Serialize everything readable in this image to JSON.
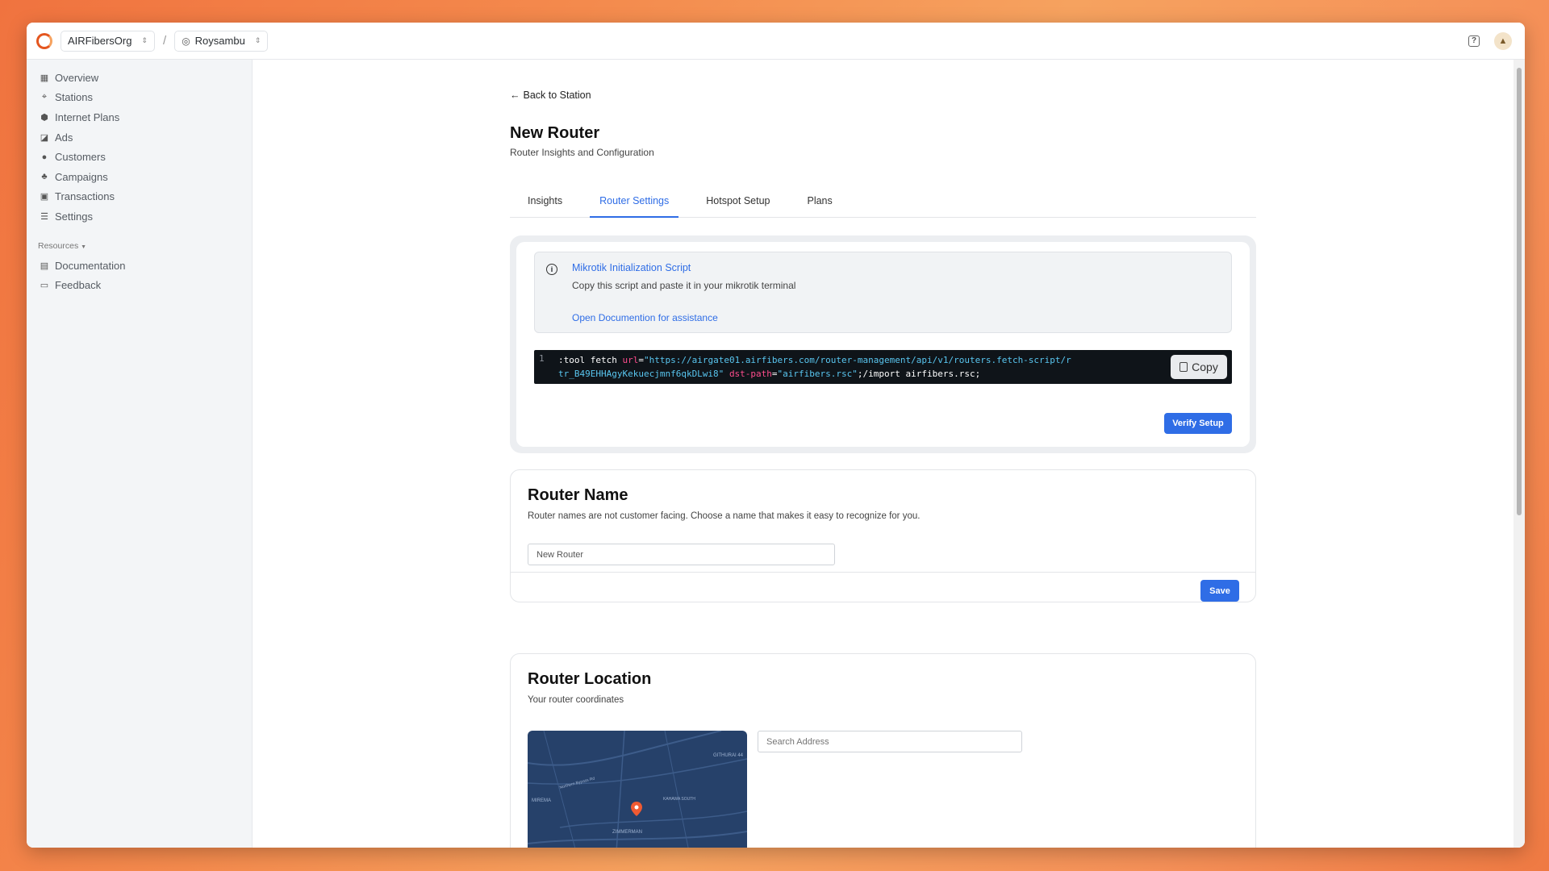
{
  "topbar": {
    "org": "AIRFibersOrg",
    "station": "Roysambu"
  },
  "sidebar": {
    "items": [
      {
        "label": "Overview",
        "icon": "grid-icon"
      },
      {
        "label": "Stations",
        "icon": "antenna-icon"
      },
      {
        "label": "Internet Plans",
        "icon": "cube-icon"
      },
      {
        "label": "Ads",
        "icon": "megaphone-icon"
      },
      {
        "label": "Customers",
        "icon": "user-circle-icon"
      },
      {
        "label": "Campaigns",
        "icon": "users-icon"
      },
      {
        "label": "Transactions",
        "icon": "money-icon"
      },
      {
        "label": "Settings",
        "icon": "sliders-icon"
      }
    ],
    "resources_label": "Resources",
    "resources": [
      {
        "label": "Documentation",
        "icon": "book-icon"
      },
      {
        "label": "Feedback",
        "icon": "message-icon"
      }
    ]
  },
  "page": {
    "back_label": "Back to Station",
    "title": "New Router",
    "subtitle": "Router Insights and Configuration",
    "tabs": [
      {
        "label": "Insights"
      },
      {
        "label": "Router Settings"
      },
      {
        "label": "Hotspot Setup"
      },
      {
        "label": "Plans"
      }
    ],
    "active_tab": "Router Settings"
  },
  "script": {
    "alert_title": "Mikrotik Initialization Script",
    "alert_desc": "Copy this script and paste it in your mikrotik terminal",
    "doc_link": "Open Documention for assistance",
    "line_number": "1",
    "code_cmd": ":tool fetch ",
    "code_url_attr": "url",
    "code_url_val": "\"https://airgate01.airfibers.com/router-management/api/v1/routers.fetch-script/rtr_B49EHHAgyKekuecjmnf6qkDLwi8\"",
    "code_dst_attr": "dst-path",
    "code_dst_val": "\"airfibers.rsc\"",
    "code_tail": ";/import airfibers.rsc;",
    "copy_label": "Copy",
    "verify_label": "Verify Setup"
  },
  "router_name": {
    "heading": "Router Name",
    "desc": "Router names are not customer facing. Choose a name that makes it easy to recognize for you.",
    "value": "New Router",
    "save_label": "Save"
  },
  "router_location": {
    "heading": "Router Location",
    "desc": "Your router coordinates",
    "search_placeholder": "Search Address",
    "map_labels": [
      "GITHURAI 44",
      "MIREMA",
      "ZIMMERMAN",
      "Northern Bypass Rd",
      "KAHAWA SOUTH"
    ]
  }
}
